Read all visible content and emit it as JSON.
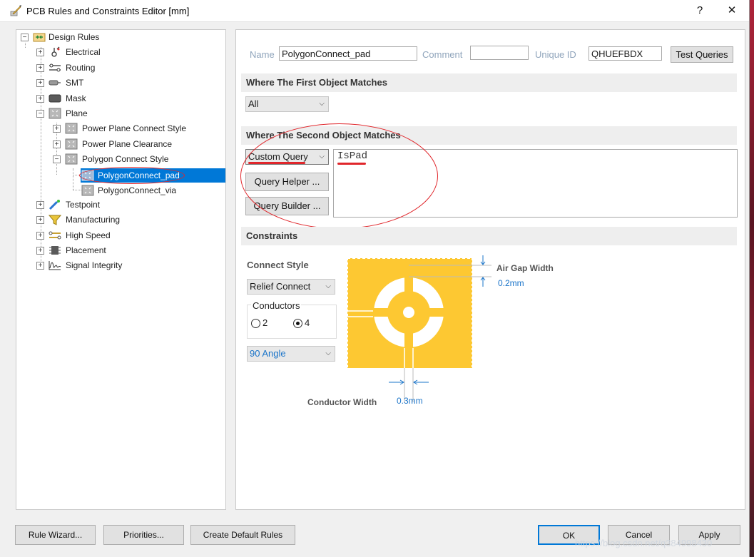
{
  "window": {
    "title": "PCB Rules and Constraints Editor [mm]",
    "help_label": "?",
    "close_label": "✕"
  },
  "tree": {
    "root": "Design Rules",
    "items": {
      "electrical": "Electrical",
      "routing": "Routing",
      "smt": "SMT",
      "mask": "Mask",
      "plane": "Plane",
      "power_plane_connect": "Power Plane Connect Style",
      "power_plane_clearance": "Power Plane Clearance",
      "polygon_connect_style": "Polygon Connect Style",
      "polygon_connect_pad": "PolygonConnect_pad",
      "polygon_connect_via": "PolygonConnect_via",
      "testpoint": "Testpoint",
      "manufacturing": "Manufacturing",
      "high_speed": "High Speed",
      "placement": "Placement",
      "signal_integrity": "Signal Integrity"
    }
  },
  "rule": {
    "name_label": "Name",
    "name_value": "PolygonConnect_pad",
    "comment_label": "Comment",
    "comment_value": "",
    "uid_label": "Unique ID",
    "uid_value": "QHUEFBDX",
    "test_queries_label": "Test Queries"
  },
  "first_match": {
    "header": "Where The First Object Matches",
    "selected": "All"
  },
  "second_match": {
    "header": "Where The Second Object Matches",
    "selected": "Custom Query",
    "query_helper_label": "Query Helper ...",
    "query_builder_label": "Query Builder ...",
    "query_text": "IsPad"
  },
  "constraints": {
    "header": "Constraints",
    "connect_style_label": "Connect Style",
    "connect_style_value": "Relief Connect",
    "conductors_label": "Conductors",
    "conductors_option_2": "2",
    "conductors_option_4": "4",
    "conductors_selected": "4",
    "angle_value": "90 Angle",
    "air_gap_label": "Air Gap Width",
    "air_gap_value": "0.2mm",
    "conductor_width_label": "Conductor Width",
    "conductor_width_value": "0.3mm"
  },
  "footer": {
    "rule_wizard": "Rule Wizard...",
    "priorities": "Priorities...",
    "create_default_rules": "Create Default Rules",
    "ok": "OK",
    "cancel": "Cancel",
    "apply": "Apply"
  },
  "watermark": "https://blog.csdn.net/q384998430",
  "colors": {
    "selection": "#0078d7",
    "annotation_red": "#e0262b",
    "diagram_copper": "#fdc832",
    "value_blue": "#1a74c9"
  }
}
